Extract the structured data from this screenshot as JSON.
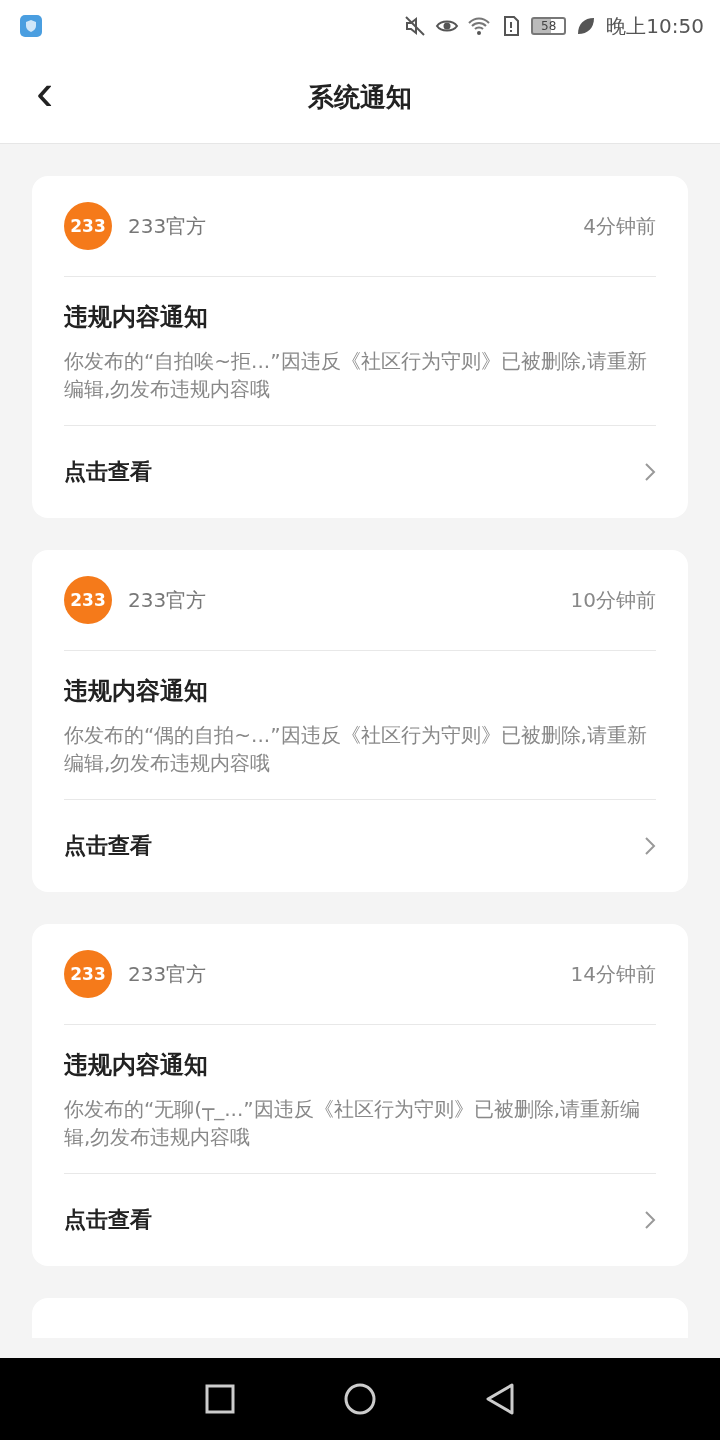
{
  "status_bar": {
    "battery": "58",
    "time": "晚上10:50"
  },
  "header": {
    "back": "‹",
    "title": "系统通知"
  },
  "notifications": [
    {
      "logo": "233",
      "sender": "233官方",
      "time": "4分钟前",
      "title": "违规内容通知",
      "body": "你发布的“自拍唉~拒...”因违反《社区行为守则》已被删除,请重新编辑,勿发布违规内容哦",
      "action": "点击查看"
    },
    {
      "logo": "233",
      "sender": "233官方",
      "time": "10分钟前",
      "title": "违规内容通知",
      "body": "你发布的“偶的自拍~...”因违反《社区行为守则》已被删除,请重新编辑,勿发布违规内容哦",
      "action": "点击查看"
    },
    {
      "logo": "233",
      "sender": "233官方",
      "time": "14分钟前",
      "title": "违规内容通知",
      "body": "你发布的“无聊(┬_...”因违反《社区行为守则》已被删除,请重新编辑,勿发布违规内容哦",
      "action": "点击查看"
    }
  ]
}
